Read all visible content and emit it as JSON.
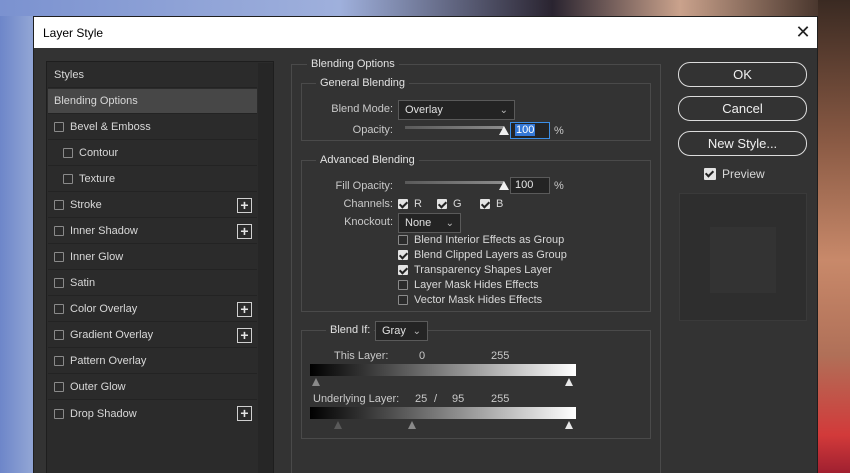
{
  "dialog": {
    "title": "Layer Style",
    "close_glyph": "✕"
  },
  "styles_list": {
    "items": [
      {
        "label": "Styles",
        "checkbox": false,
        "indent": false,
        "plus": false,
        "selected": false
      },
      {
        "label": "Blending Options",
        "checkbox": false,
        "indent": false,
        "plus": false,
        "selected": true
      },
      {
        "label": "Bevel & Emboss",
        "checkbox": true,
        "checked": false,
        "indent": false,
        "plus": false
      },
      {
        "label": "Contour",
        "checkbox": true,
        "checked": false,
        "indent": true,
        "plus": false
      },
      {
        "label": "Texture",
        "checkbox": true,
        "checked": false,
        "indent": true,
        "plus": false
      },
      {
        "label": "Stroke",
        "checkbox": true,
        "checked": false,
        "indent": false,
        "plus": true
      },
      {
        "label": "Inner Shadow",
        "checkbox": true,
        "checked": false,
        "indent": false,
        "plus": true
      },
      {
        "label": "Inner Glow",
        "checkbox": true,
        "checked": false,
        "indent": false,
        "plus": false
      },
      {
        "label": "Satin",
        "checkbox": true,
        "checked": false,
        "indent": false,
        "plus": false
      },
      {
        "label": "Color Overlay",
        "checkbox": true,
        "checked": false,
        "indent": false,
        "plus": true
      },
      {
        "label": "Gradient Overlay",
        "checkbox": true,
        "checked": false,
        "indent": false,
        "plus": true
      },
      {
        "label": "Pattern Overlay",
        "checkbox": true,
        "checked": false,
        "indent": false,
        "plus": false
      },
      {
        "label": "Outer Glow",
        "checkbox": true,
        "checked": false,
        "indent": false,
        "plus": false
      },
      {
        "label": "Drop Shadow",
        "checkbox": true,
        "checked": false,
        "indent": false,
        "plus": true
      }
    ],
    "plus_glyph": "+"
  },
  "blending_options": {
    "section_title": "Blending Options",
    "general": {
      "title": "General Blending",
      "blend_mode_label": "Blend Mode:",
      "blend_mode_value": "Overlay",
      "opacity_label": "Opacity:",
      "opacity_value": "100",
      "opacity_level": 1.0,
      "percent": "%"
    },
    "advanced": {
      "title": "Advanced Blending",
      "fill_opacity_label": "Fill Opacity:",
      "fill_opacity_value": "100",
      "fill_opacity_level": 1.0,
      "percent": "%",
      "channels_label": "Channels:",
      "channel_r": "R",
      "channel_g": "G",
      "channel_b": "B",
      "knockout_label": "Knockout:",
      "knockout_value": "None",
      "options": [
        {
          "label": "Blend Interior Effects as Group",
          "checked": false
        },
        {
          "label": "Blend Clipped Layers as Group",
          "checked": true
        },
        {
          "label": "Transparency Shapes Layer",
          "checked": true
        },
        {
          "label": "Layer Mask Hides Effects",
          "checked": false
        },
        {
          "label": "Vector Mask Hides Effects",
          "checked": false
        }
      ]
    },
    "blend_if": {
      "label": "Blend If:",
      "value": "Gray",
      "this_layer_label": "This Layer:",
      "this_layer_low": "0",
      "this_layer_high": "255",
      "underlying_label": "Underlying Layer:",
      "underlying_low": "25",
      "underlying_sep": "/",
      "underlying_mid": "95",
      "underlying_high": "255"
    }
  },
  "buttons": {
    "ok": "OK",
    "cancel": "Cancel",
    "new_style": "New Style...",
    "preview_label": "Preview",
    "preview_checked": true
  },
  "colors": {
    "dialog_bg": "#333333",
    "selected_item": "#474747",
    "focus_blue": "#3478d6"
  },
  "icons": {
    "close": "close-icon",
    "dropdown": "chevron-down-icon",
    "add": "plus-icon",
    "checkbox": "checkbox-icon"
  }
}
